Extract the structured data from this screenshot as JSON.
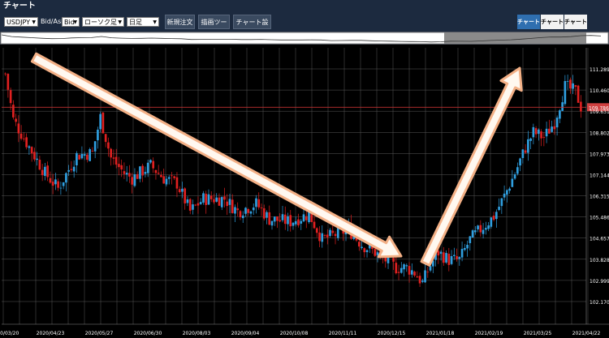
{
  "title": "チャート",
  "toolbar": {
    "symbol": "USDJPY",
    "bidask_label": "Bid/Ask",
    "bidask_value": "Bid",
    "chart_style": "ローソク足",
    "period": "日足",
    "new_order": "新規注文",
    "drawing_tool": "描画ツール",
    "chart_settings": "チャート設定"
  },
  "chart_tabs": [
    "チャート1",
    "チャート2",
    "チャート3"
  ],
  "current_price": "109.786",
  "colors": {
    "up": "#2f9fe0",
    "down": "#e02020",
    "arrow": "#f3b086",
    "active_tab": "#2f6fb0"
  },
  "chart_data": {
    "type": "candlestick",
    "y_ticks": [
      "111.289",
      "110.460",
      "109.631",
      "108.802",
      "107.973",
      "107.144",
      "106.315",
      "105.486",
      "104.657",
      "103.828",
      "102.999",
      "102.170"
    ],
    "x_ticks": [
      "2020/03/20",
      "2020/04/23",
      "2020/05/27",
      "2020/06/30",
      "2020/08/03",
      "2020/09/04",
      "2020/10/08",
      "2020/11/11",
      "2020/12/15",
      "2021/01/18",
      "2021/02/19",
      "2021/03/25",
      "2021/04/22"
    ],
    "ylim": [
      102.0,
      112.0
    ],
    "grid": true,
    "path": [
      [
        0,
        111.1
      ],
      [
        3,
        109.3
      ],
      [
        8,
        108.4
      ],
      [
        15,
        107.2
      ],
      [
        20,
        106.6
      ],
      [
        27,
        107.9
      ],
      [
        33,
        108.0
      ],
      [
        36,
        109.4
      ],
      [
        40,
        107.8
      ],
      [
        45,
        107.2
      ],
      [
        48,
        107.0
      ],
      [
        55,
        107.5
      ],
      [
        60,
        107.0
      ],
      [
        65,
        106.8
      ],
      [
        70,
        105.7
      ],
      [
        75,
        106.2
      ],
      [
        83,
        106.2
      ],
      [
        88,
        105.7
      ],
      [
        95,
        106.0
      ],
      [
        100,
        105.4
      ],
      [
        108,
        105.3
      ],
      [
        115,
        105.6
      ],
      [
        120,
        104.6
      ],
      [
        125,
        104.8
      ],
      [
        130,
        105.0
      ],
      [
        135,
        104.4
      ],
      [
        140,
        104.1
      ],
      [
        148,
        103.5
      ],
      [
        152,
        103.5
      ],
      [
        155,
        103.3
      ],
      [
        158,
        102.9
      ],
      [
        161,
        103.6
      ],
      [
        164,
        104.1
      ],
      [
        168,
        103.8
      ],
      [
        172,
        103.8
      ],
      [
        176,
        104.6
      ],
      [
        180,
        105.0
      ],
      [
        185,
        105.5
      ],
      [
        189,
        106.3
      ],
      [
        193,
        107.2
      ],
      [
        197,
        108.2
      ],
      [
        200,
        108.8
      ],
      [
        204,
        108.6
      ],
      [
        208,
        109.2
      ],
      [
        212,
        110.6
      ],
      [
        216,
        110.4
      ],
      [
        218,
        109.8
      ]
    ]
  }
}
